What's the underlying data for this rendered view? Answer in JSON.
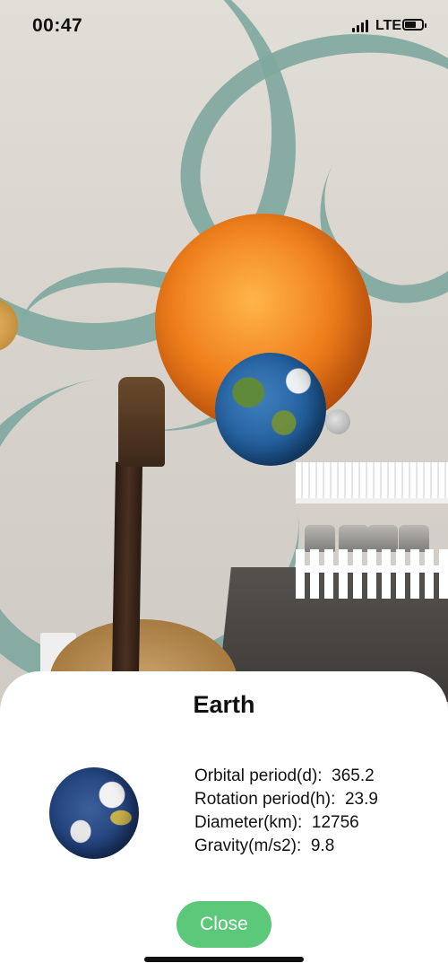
{
  "status_bar": {
    "time": "00:47",
    "network": "LTE",
    "battery_level": 0.65,
    "signal_bars": 4
  },
  "scene": {
    "planets": [
      {
        "name": "sun",
        "icon": "sun-icon"
      },
      {
        "name": "earth",
        "icon": "earth-icon"
      },
      {
        "name": "moon",
        "icon": "moon-icon"
      },
      {
        "name": "venus",
        "icon": "venus-icon"
      }
    ]
  },
  "info_panel": {
    "title": "Earth",
    "planet_image": "earth-thumbnail-icon",
    "rows": [
      {
        "label": "Orbital period(d):",
        "value": "365.2"
      },
      {
        "label": "Rotation period(h):",
        "value": "23.9"
      },
      {
        "label": "Diameter(km):",
        "value": "12756"
      },
      {
        "label": "Gravity(m/s2):",
        "value": "9.8"
      }
    ],
    "close_label": "Close"
  },
  "colors": {
    "close_button": "#5cc97a",
    "sheet_background": "#ffffff",
    "wall_motif": "#7fa89f",
    "sun": "#f0801c",
    "earth_ocean": "#1f5a98"
  }
}
